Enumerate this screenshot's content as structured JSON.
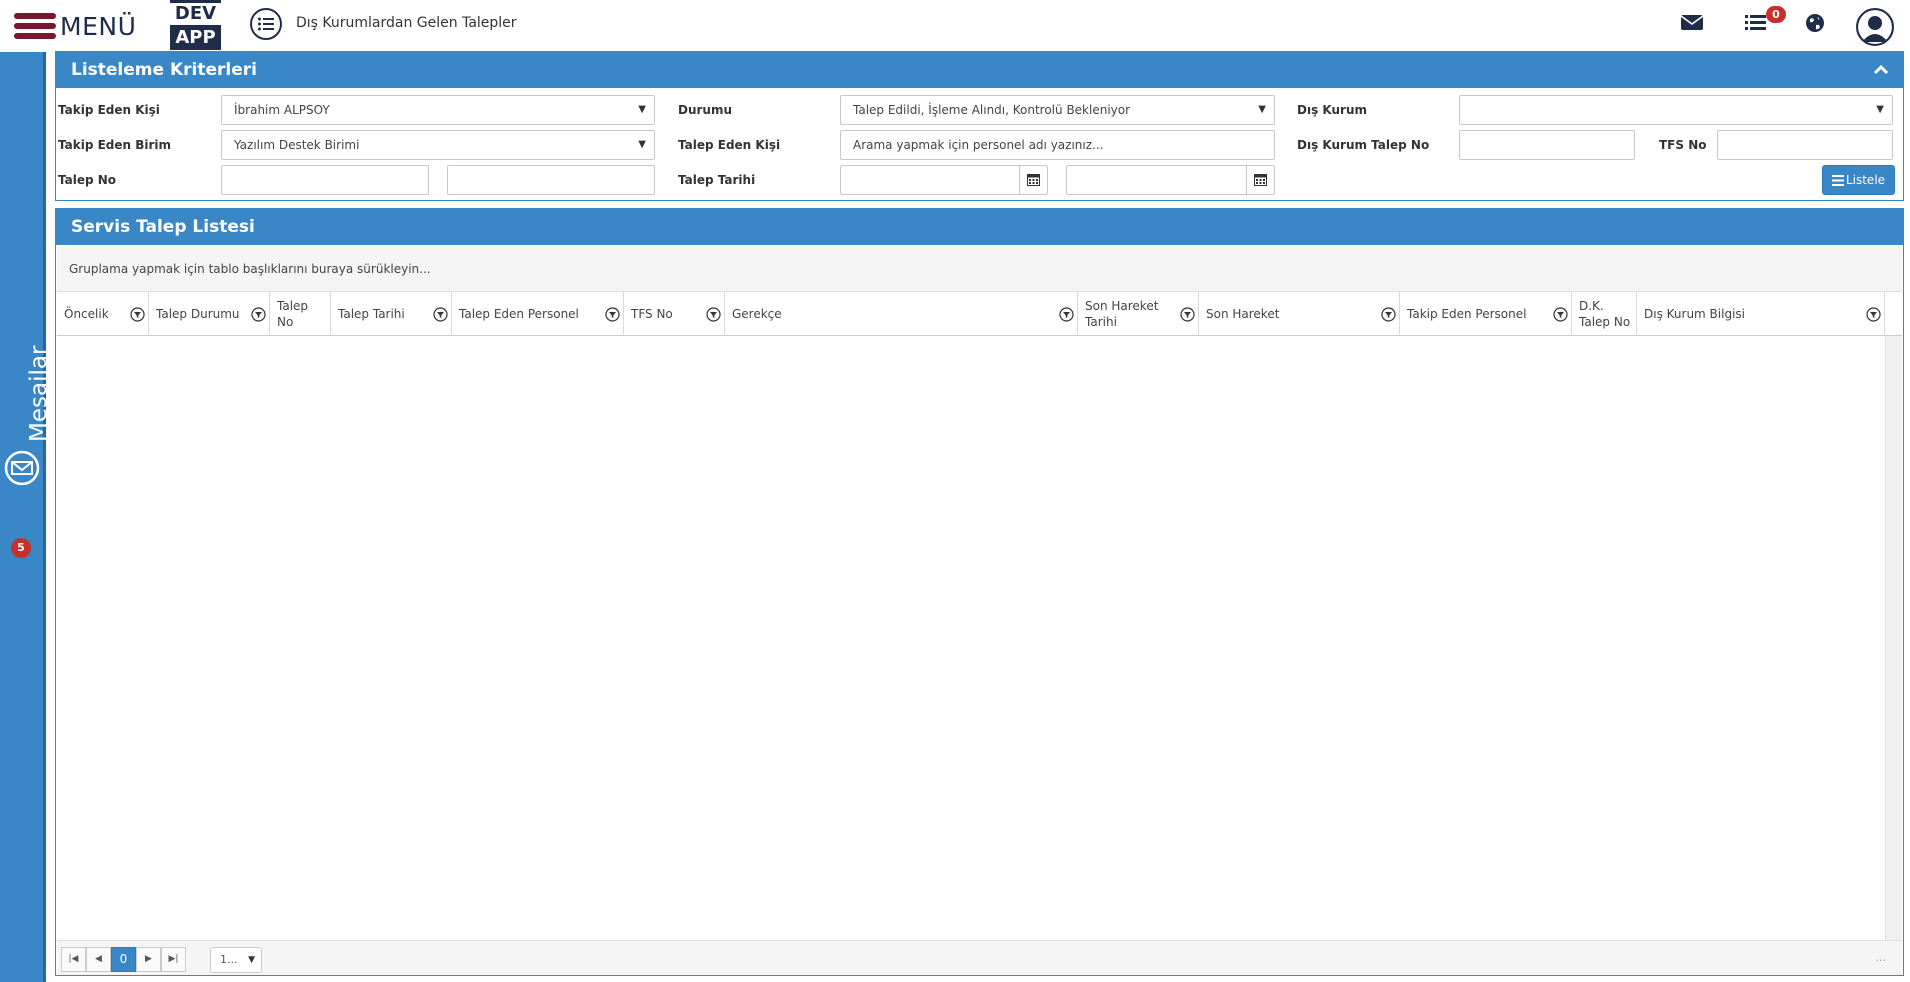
{
  "header": {
    "menu_label": "MENÜ",
    "logo_top": "DEV",
    "logo_bottom": "APP",
    "page_title": "Dış Kurumlardan Gelen Talepler",
    "tasks_badge": "0",
    "icons": [
      "list-circle-icon",
      "envelope-icon",
      "tasks-icon",
      "globe-icon",
      "user-avatar-icon"
    ]
  },
  "side": {
    "label": "Mesajlar",
    "badge": "5"
  },
  "criteria": {
    "title": "Listeleme Kriterleri",
    "takip_eden_kisi_label": "Takip Eden Kişi",
    "takip_eden_kisi_value": "İbrahim ALPSOY",
    "durumu_label": "Durumu",
    "durumu_value": "Talep Edildi, İşleme Alındı, Kontrolü Bekleniyor",
    "dis_kurum_label": "Dış Kurum",
    "dis_kurum_value": "",
    "takip_eden_birim_label": "Takip Eden Birim",
    "takip_eden_birim_value": "Yazılım Destek Birimi",
    "talep_eden_kisi_label": "Talep Eden Kişi",
    "talep_eden_kisi_placeholder": "Arama yapmak için personel adı yazınız...",
    "dis_kurum_talep_no_label": "Dış Kurum Talep No",
    "tfs_no_label": "TFS No",
    "talep_no_label": "Talep No",
    "talep_tarihi_label": "Talep Tarihi",
    "listele_label": "Listele"
  },
  "list": {
    "title": "Servis Talep Listesi",
    "group_hint": "Gruplama yapmak için tablo başlıklarını buraya sürükleyin...",
    "columns": [
      "Öncelik",
      "Talep Durumu",
      "Talep No",
      "Talep Tarihi",
      "Talep Eden Personel",
      "TFS No",
      "Gerekçe",
      "Son Hareket Tarihi",
      "Son Hareket",
      "Takip Eden Personel",
      "D.K. Talep No",
      "Dış Kurum Bilgisi"
    ],
    "pager": {
      "current_page": "0",
      "page_size": "1...",
      "info": "..."
    }
  },
  "colors": {
    "accent": "#3a87c8",
    "brand_dark": "#1f2d4a",
    "menu_bars": "#7a1730",
    "badge": "#c9302c"
  }
}
